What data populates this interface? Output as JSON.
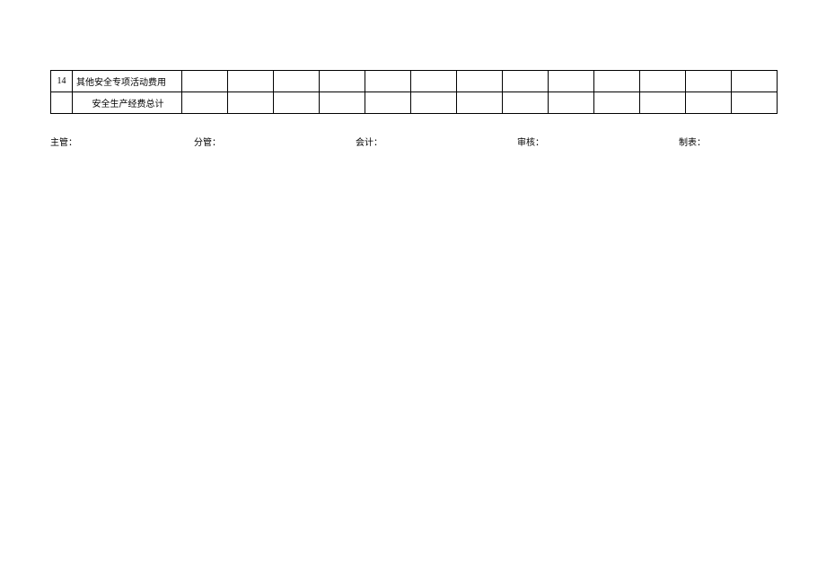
{
  "table": {
    "rows": [
      {
        "index": "14",
        "label": "其他安全专项活动费用",
        "cells": [
          "",
          "",
          "",
          "",
          "",
          "",
          "",
          "",
          "",
          "",
          "",
          "",
          ""
        ]
      },
      {
        "index": "",
        "label": "安全生产经费总计",
        "cells": [
          "",
          "",
          "",
          "",
          "",
          "",
          "",
          "",
          "",
          "",
          "",
          "",
          ""
        ]
      }
    ]
  },
  "signatures": {
    "supervisor": "主管：",
    "incharge": "分管：",
    "accountant": "会计：",
    "auditor": "审核：",
    "preparer": "制表："
  }
}
